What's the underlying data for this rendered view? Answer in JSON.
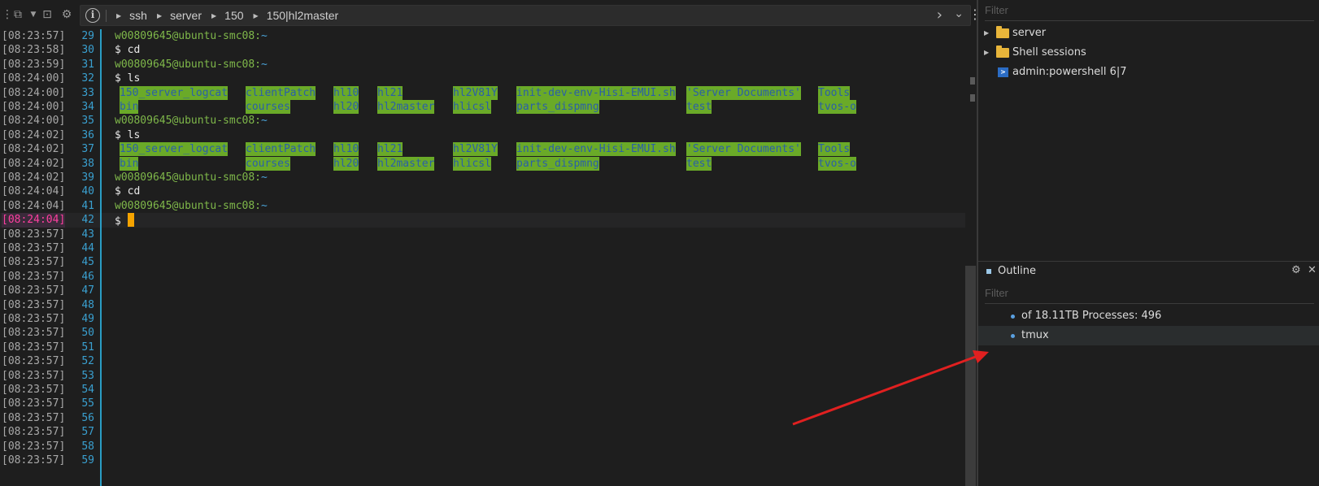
{
  "breadcrumb": [
    "ssh",
    "server",
    "150",
    "150|hl2master"
  ],
  "terminal": {
    "lines": [
      {
        "ts": "[08:23:57]",
        "n": "29",
        "kind": "prompt",
        "user": "w00809645@ubuntu-smc08:",
        "path": "~"
      },
      {
        "ts": "[08:23:58]",
        "n": "30",
        "kind": "cmd",
        "text": "$ cd"
      },
      {
        "ts": "[08:23:59]",
        "n": "31",
        "kind": "prompt",
        "user": "w00809645@ubuntu-smc08:",
        "path": "~"
      },
      {
        "ts": "[08:24:00]",
        "n": "32",
        "kind": "cmd",
        "text": "$ ls"
      },
      {
        "ts": "[08:24:00]",
        "n": "33",
        "kind": "ls1"
      },
      {
        "ts": "[08:24:00]",
        "n": "34",
        "kind": "ls2"
      },
      {
        "ts": "[08:24:00]",
        "n": "35",
        "kind": "prompt",
        "user": "w00809645@ubuntu-smc08:",
        "path": "~"
      },
      {
        "ts": "[08:24:02]",
        "n": "36",
        "kind": "cmd",
        "text": "$ ls"
      },
      {
        "ts": "[08:24:02]",
        "n": "37",
        "kind": "ls1"
      },
      {
        "ts": "[08:24:02]",
        "n": "38",
        "kind": "ls2"
      },
      {
        "ts": "[08:24:02]",
        "n": "39",
        "kind": "prompt",
        "user": "w00809645@ubuntu-smc08:",
        "path": "~"
      },
      {
        "ts": "[08:24:04]",
        "n": "40",
        "kind": "cmd",
        "text": "$ cd"
      },
      {
        "ts": "[08:24:04]",
        "n": "41",
        "kind": "prompt",
        "user": "w00809645@ubuntu-smc08:",
        "path": "~"
      },
      {
        "ts": "[08:24:04]",
        "n": "42",
        "kind": "active",
        "text": "$ "
      },
      {
        "ts": "[08:23:57]",
        "n": "43",
        "kind": "empty"
      },
      {
        "ts": "[08:23:57]",
        "n": "44",
        "kind": "empty"
      },
      {
        "ts": "[08:23:57]",
        "n": "45",
        "kind": "empty"
      },
      {
        "ts": "[08:23:57]",
        "n": "46",
        "kind": "empty"
      },
      {
        "ts": "[08:23:57]",
        "n": "47",
        "kind": "empty"
      },
      {
        "ts": "[08:23:57]",
        "n": "48",
        "kind": "empty"
      },
      {
        "ts": "[08:23:57]",
        "n": "49",
        "kind": "empty"
      },
      {
        "ts": "[08:23:57]",
        "n": "50",
        "kind": "empty"
      },
      {
        "ts": "[08:23:57]",
        "n": "51",
        "kind": "empty"
      },
      {
        "ts": "[08:23:57]",
        "n": "52",
        "kind": "empty"
      },
      {
        "ts": "[08:23:57]",
        "n": "53",
        "kind": "empty"
      },
      {
        "ts": "[08:23:57]",
        "n": "54",
        "kind": "empty"
      },
      {
        "ts": "[08:23:57]",
        "n": "55",
        "kind": "empty"
      },
      {
        "ts": "[08:23:57]",
        "n": "56",
        "kind": "empty"
      },
      {
        "ts": "[08:23:57]",
        "n": "57",
        "kind": "empty"
      },
      {
        "ts": "[08:23:57]",
        "n": "58",
        "kind": "empty"
      },
      {
        "ts": "[08:23:57]",
        "n": "59",
        "kind": "empty"
      }
    ],
    "ls_row1": [
      "150_server_logcat",
      "clientPatch",
      "hl10",
      "hl21",
      "hl2V81Y",
      "init-dev-env-Hisi-EMUI.sh",
      "'Server Documents'",
      "Tools"
    ],
    "ls_row2": [
      "bin",
      "courses",
      "hl20",
      "hl2master",
      "hlicsl",
      "parts_dispmng",
      "test",
      "tvos-o"
    ]
  },
  "sidebar": {
    "filter_placeholder": "Filter",
    "tree": [
      {
        "label": "server",
        "type": "folder"
      },
      {
        "label": "Shell sessions",
        "type": "folder"
      },
      {
        "label": "admin:powershell 6|7",
        "type": "powershell"
      }
    ],
    "outline": {
      "title": "Outline",
      "filter_placeholder": "Filter",
      "items": [
        "of 18.11TB Processes: 496",
        "tmux"
      ]
    }
  },
  "colors": {
    "ls_highlight_bg": "#6aaa28",
    "ls_highlight_fg": "#2a5fa8",
    "cursor": "#f5a300",
    "active_timestamp": "#ff3fa0",
    "annotation_arrow": "#e02020"
  }
}
